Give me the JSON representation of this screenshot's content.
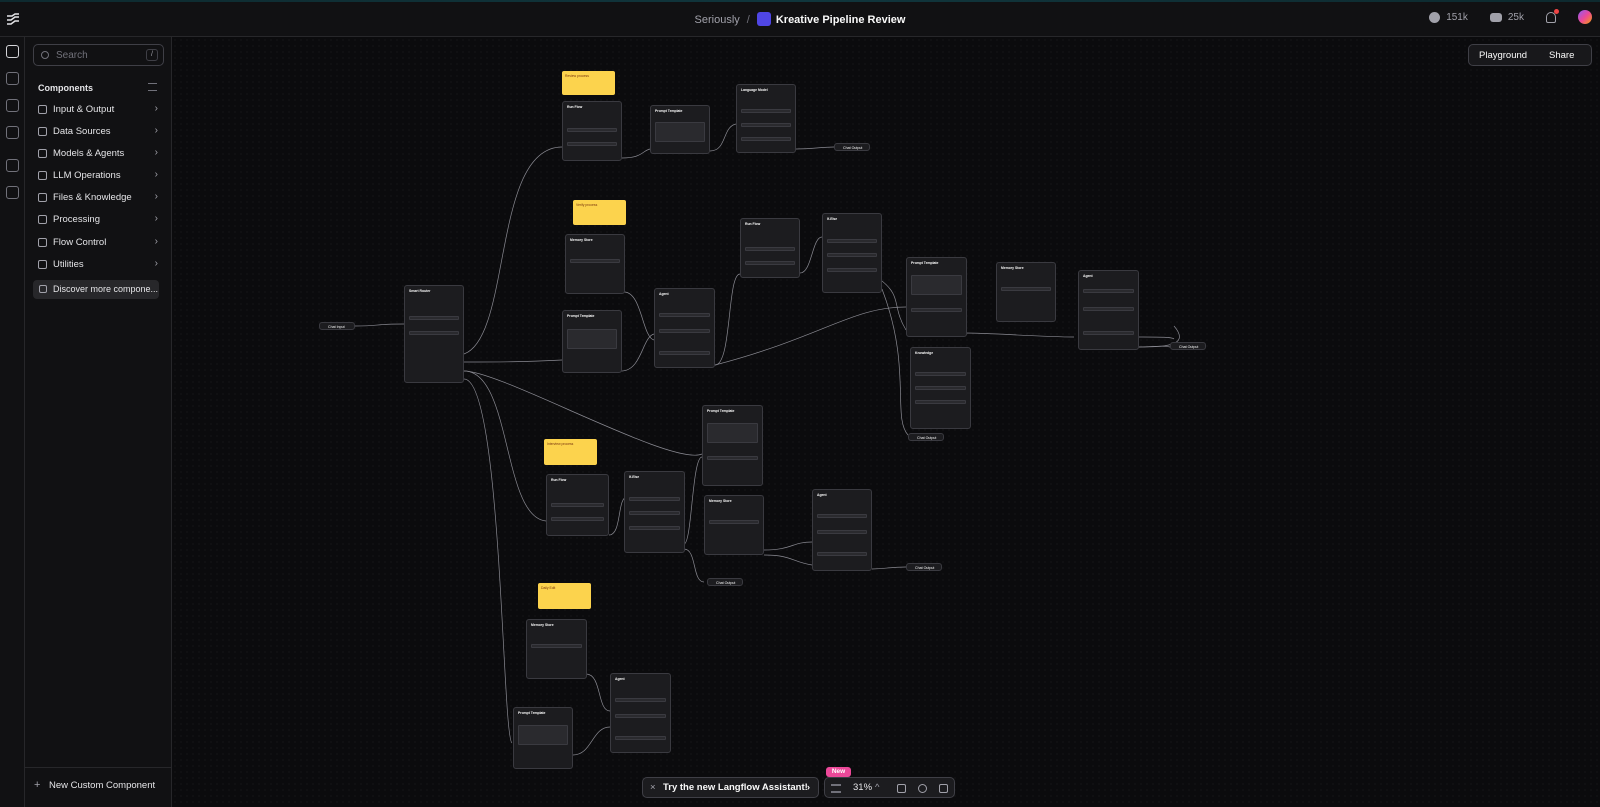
{
  "header": {
    "breadcrumb_parent": "Seriously",
    "separator": "/",
    "flow_title": "Kreative Pipeline Review",
    "github_count": "151k",
    "discord_count": "25k"
  },
  "sidebar": {
    "search_placeholder": "Search",
    "search_shortcut": "/",
    "section_title": "Components",
    "items": [
      {
        "label": "Input & Output",
        "icon": "input-output-icon"
      },
      {
        "label": "Data Sources",
        "icon": "database-icon"
      },
      {
        "label": "Models & Agents",
        "icon": "models-icon"
      },
      {
        "label": "LLM Operations",
        "icon": "llm-icon"
      },
      {
        "label": "Files & Knowledge",
        "icon": "files-icon"
      },
      {
        "label": "Processing",
        "icon": "processing-icon"
      },
      {
        "label": "Flow Control",
        "icon": "flow-control-icon"
      },
      {
        "label": "Utilities",
        "icon": "utilities-icon"
      }
    ],
    "discover_label": "Discover more compone...",
    "new_component_label": "New Custom Component"
  },
  "toolbar": {
    "playground_label": "Playground",
    "share_label": "Share"
  },
  "canvas": {
    "notes": [
      "Review process",
      "Verify process",
      "Interview process",
      "Daily Edit"
    ],
    "nodes": {
      "chat_input": "Chat Input",
      "smart_router": "Smart Router",
      "sub_flow_1": "Run Flow",
      "prompt_1": "Prompt Template",
      "language_model": "Language Model",
      "chat_output_1": "Chat Output",
      "memory_store_1": "Memory Store",
      "prompt_2": "Prompt Template",
      "agent_1": "Agent",
      "sub_flow_2": "Run Flow",
      "if_else_1": "If-Else",
      "prompt_3": "Prompt Template",
      "memory_store_2": "Memory Store",
      "agent_2": "Agent",
      "chat_output_2": "Chat Output",
      "knowledge": "Knowledge",
      "chat_output_3": "Chat Output",
      "prompt_4": "Prompt Template",
      "sub_flow_3": "Run Flow",
      "if_else_2": "If-Else",
      "memory_store_3": "Memory Store",
      "agent_3": "Agent",
      "chat_output_4": "Chat Output",
      "chat_output_5": "Chat Output",
      "memory_store_4": "Memory Store",
      "agent_4": "Agent",
      "prompt_5": "Prompt Template"
    }
  },
  "bottom": {
    "assistant_label": "Try the new Langflow Assistant!",
    "new_badge": "New",
    "zoom": "31%"
  },
  "colors": {
    "accent": "#6366f1",
    "note": "#fcd34d",
    "badge": "#ec4899"
  }
}
